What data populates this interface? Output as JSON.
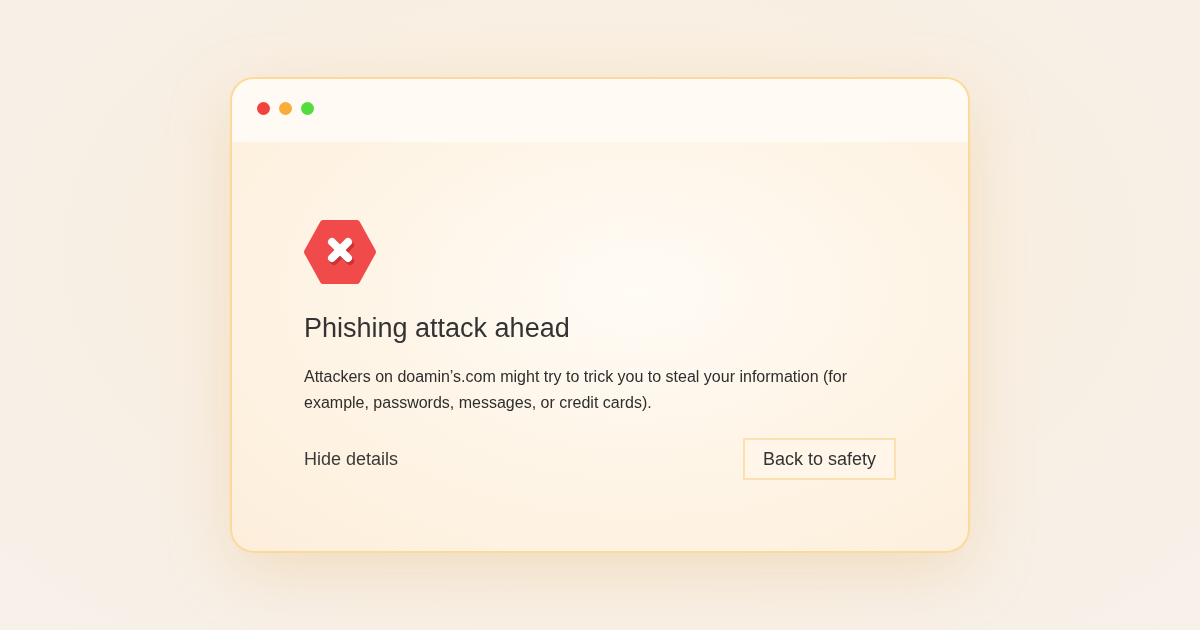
{
  "window": {
    "controls": [
      {
        "color": "#f0423f"
      },
      {
        "color": "#f8ad3a"
      },
      {
        "color": "#52dd3f"
      }
    ]
  },
  "warning": {
    "title": "Phishing attack ahead",
    "message": "Attackers on doamin’s.com might try to trick you to steal your information (for example, passwords, messages, or credit cards).",
    "details_link": "Hide details",
    "primary_button": "Back to safety"
  }
}
